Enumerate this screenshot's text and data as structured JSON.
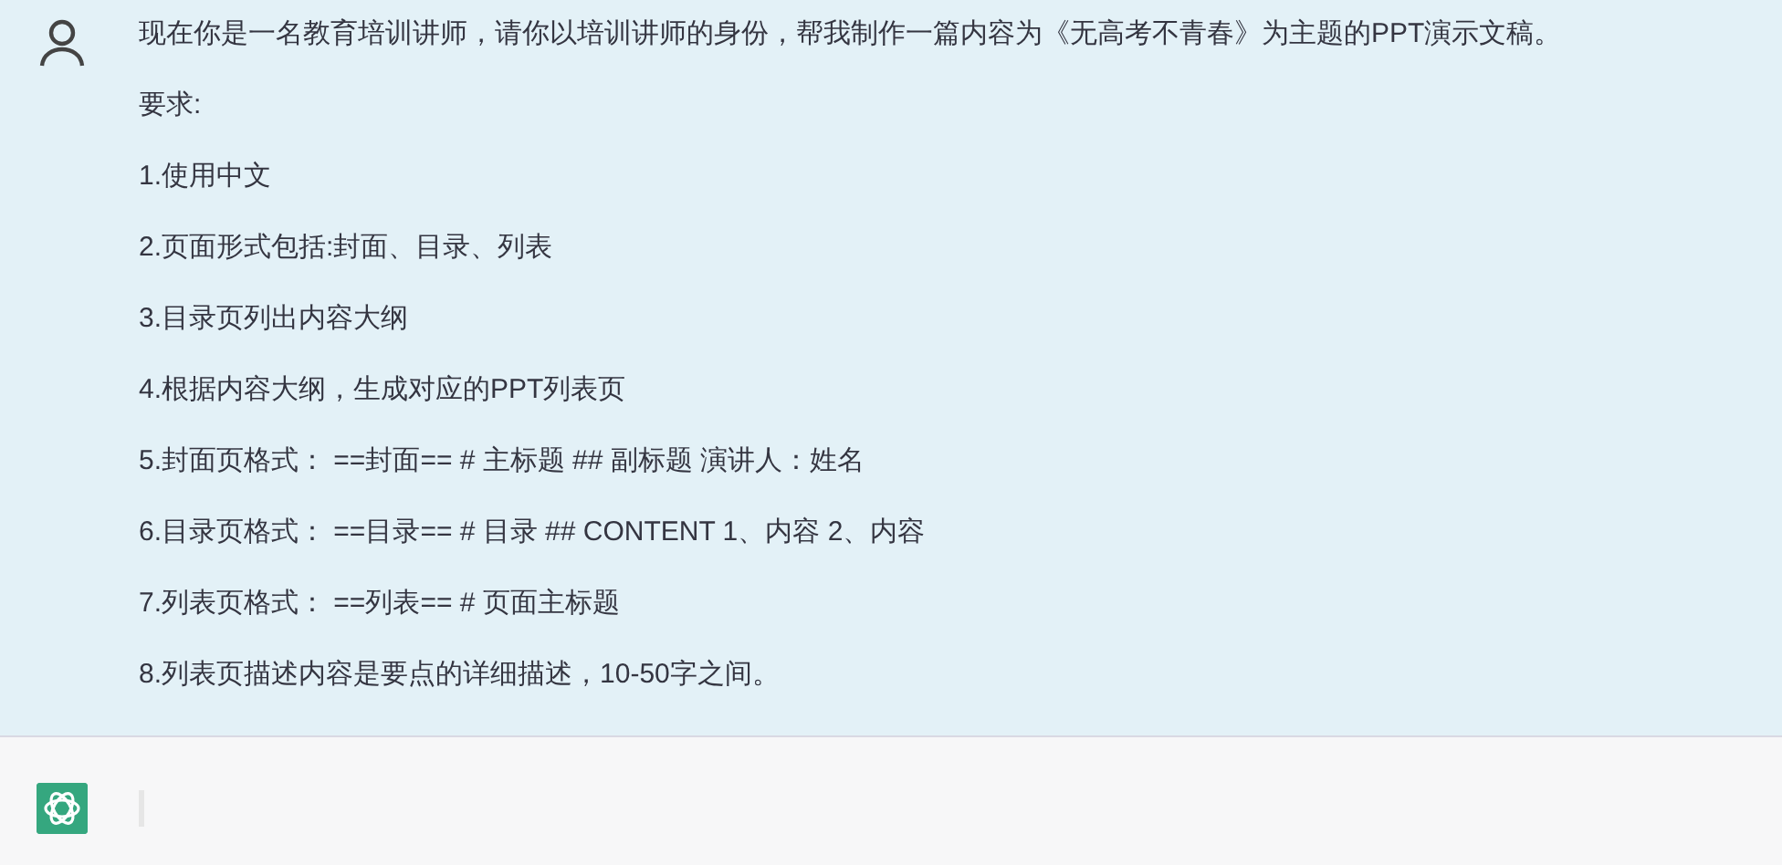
{
  "user_message": {
    "paragraphs": [
      "现在你是一名教育培训讲师，请你以培训讲师的身份，帮我制作一篇内容为《无高考不青春》为主题的PPT演示文稿。",
      "要求:",
      "1.使用中文",
      "2.页面形式包括:封面、目录、列表",
      "3.目录页列出内容大纲",
      "4.根据内容大纲，生成对应的PPT列表页",
      "5.封面页格式： ==封面== # 主标题 ## 副标题 演讲人：姓名",
      "6.目录页格式： ==目录== # 目录 ## CONTENT 1、内容 2、内容",
      "7.列表页格式： ==列表== # 页面主标题",
      "8.列表页描述内容是要点的详细描述，10-50字之间。"
    ]
  },
  "assistant_message": {
    "cursor": true
  }
}
